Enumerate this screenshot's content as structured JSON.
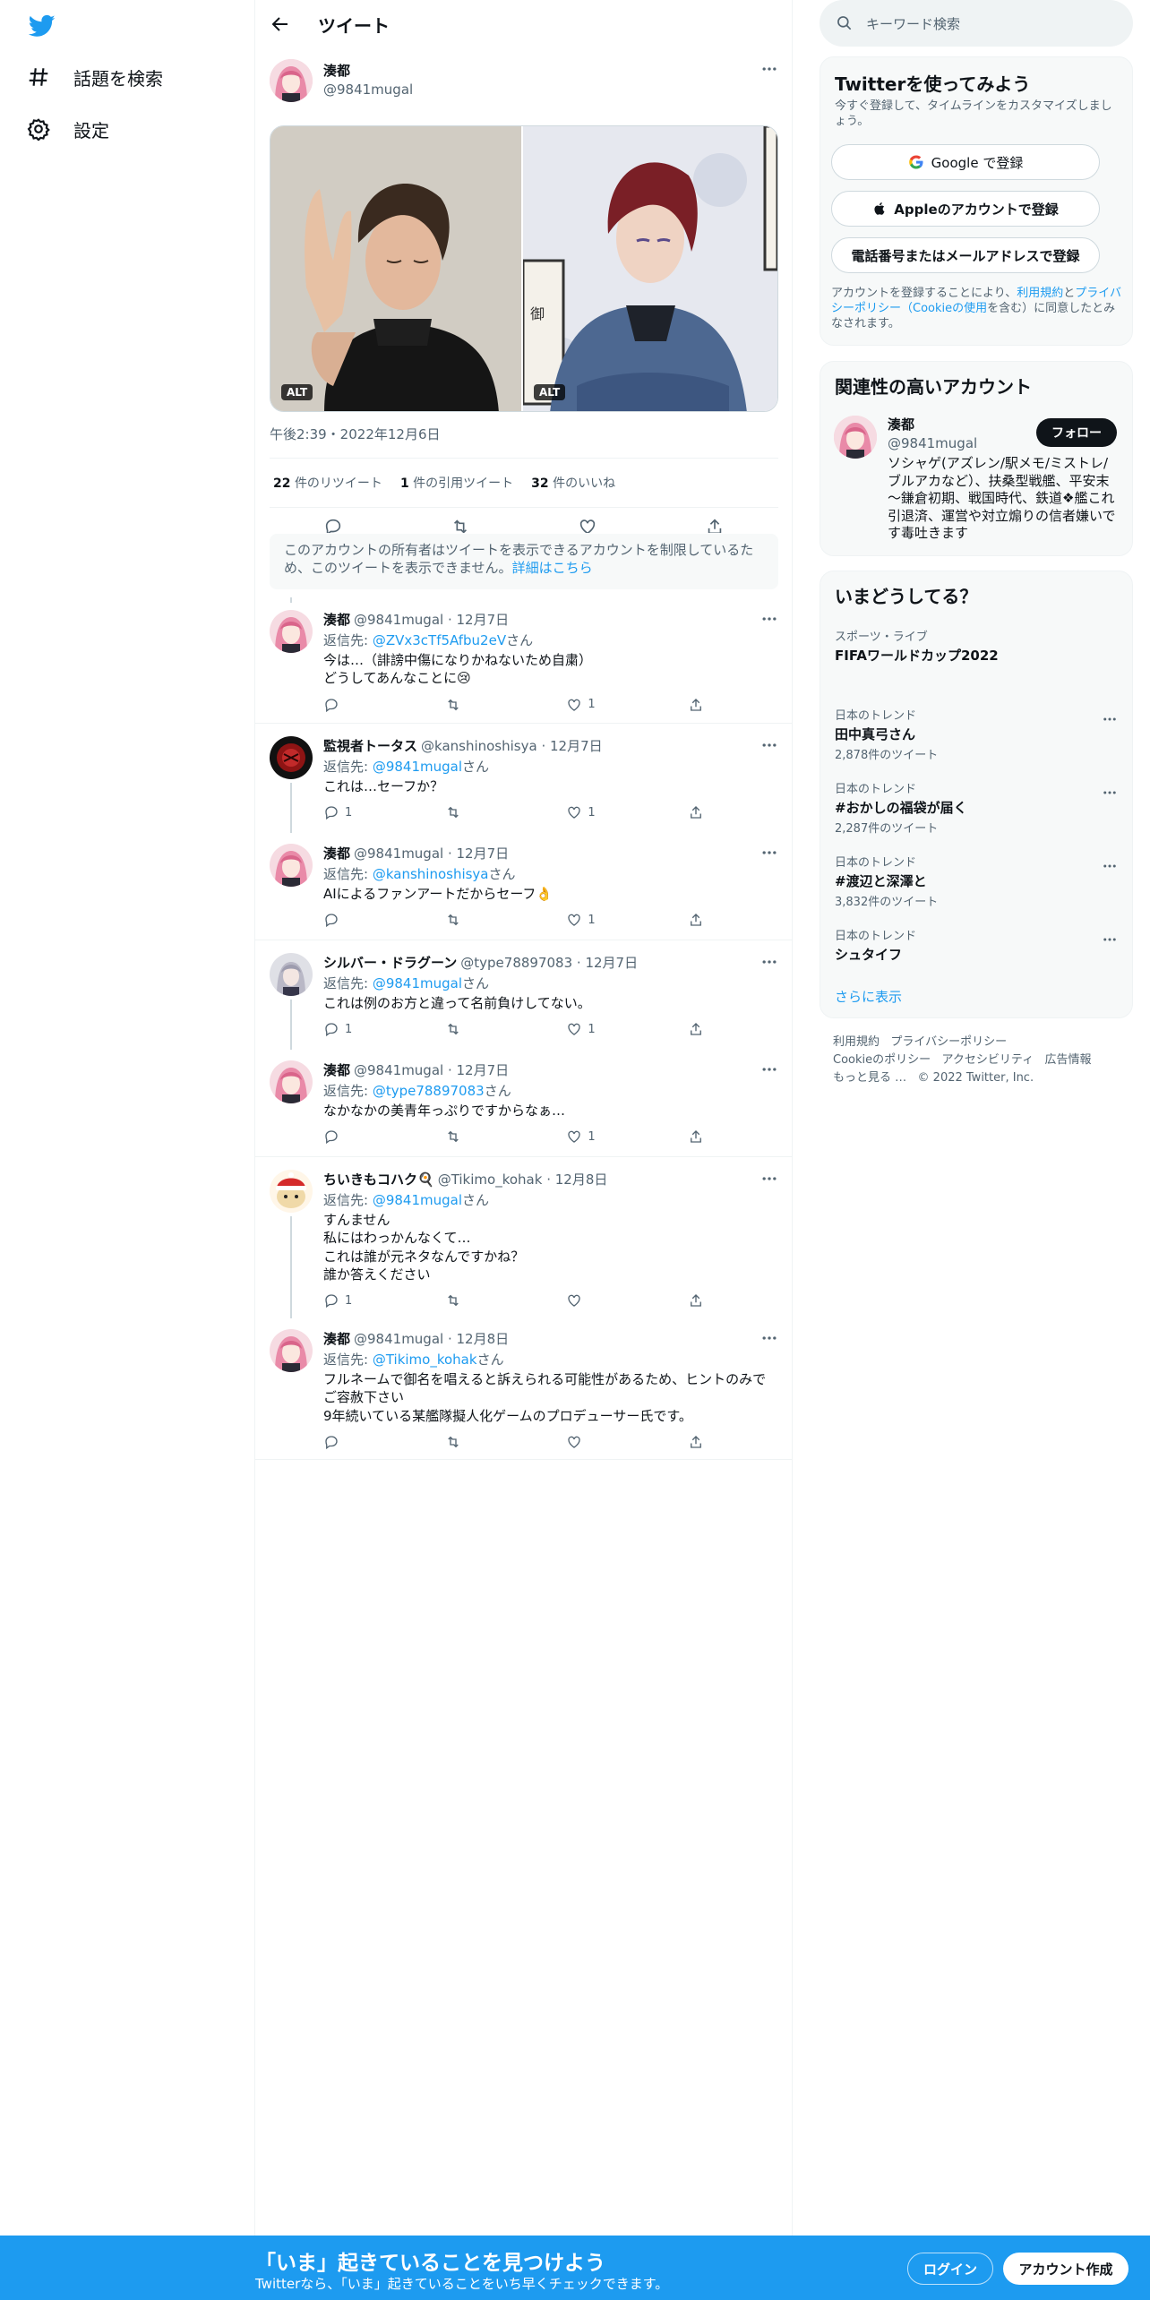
{
  "nav": {
    "search_label": "話題を検索",
    "settings_label": "設定"
  },
  "header": {
    "title": "ツイート"
  },
  "tweet": {
    "author_name": "湊都",
    "author_handle": "@9841mugal",
    "alt1": "ALT",
    "alt2": "ALT",
    "timestamp": "午後2:39・2022年12月6日",
    "retweets_count": "22",
    "retweets_label": "件のリツイート",
    "quotes_count": "1",
    "quotes_label": "件の引用ツイート",
    "likes_count": "32",
    "likes_label": "件のいいね",
    "notice_text": "このアカウントの所有者はツイートを表示できるアカウントを制限しているため、このツイートを表示できません。",
    "notice_link": "詳細はこちら"
  },
  "replies": [
    {
      "name": "湊都",
      "handle": "@9841mugal",
      "date": "12月7日",
      "reply_prefix": "返信先: ",
      "reply_to": "@ZVx3cTf5Afbu2eV",
      "reply_suffix": "さん",
      "text": "今は…（誹謗中傷になりかねないため自粛）\nどうしてあんなことに😢",
      "replies": "",
      "retweets": "",
      "likes": "1"
    },
    {
      "name": "監視者トータス",
      "handle": "@kanshinoshisya",
      "date": "12月7日",
      "reply_prefix": "返信先: ",
      "reply_to": "@9841mugal",
      "reply_suffix": "さん",
      "text": "これは…セーフか？",
      "replies": "1",
      "retweets": "",
      "likes": "1"
    },
    {
      "name": "湊都",
      "handle": "@9841mugal",
      "date": "12月7日",
      "reply_prefix": "返信先: ",
      "reply_to": "@kanshinoshisya",
      "reply_suffix": "さん",
      "text": "AIによるファンアートだからセーフ👌",
      "replies": "",
      "retweets": "",
      "likes": "1"
    },
    {
      "name": "シルバー・ドラグーン",
      "handle": "@type78897083",
      "date": "12月7日",
      "reply_prefix": "返信先: ",
      "reply_to": "@9841mugal",
      "reply_suffix": "さん",
      "text": "これは例のお方と違って名前負けしてない。",
      "replies": "1",
      "retweets": "",
      "likes": "1"
    },
    {
      "name": "湊都",
      "handle": "@9841mugal",
      "date": "12月7日",
      "reply_prefix": "返信先: ",
      "reply_to": "@type78897083",
      "reply_suffix": "さん",
      "text": "なかなかの美青年っぷりですからなぁ…",
      "replies": "",
      "retweets": "",
      "likes": "1"
    },
    {
      "name": "ちいきもコハク🍳",
      "handle": "@Tikimo_kohak",
      "date": "12月8日",
      "reply_prefix": "返信先: ",
      "reply_to": "@9841mugal",
      "reply_suffix": "さん",
      "text": "すんません\n私にはわっかんなくて…\nこれは誰が元ネタなんですかね？\n誰か答えください",
      "replies": "1",
      "retweets": "",
      "likes": ""
    },
    {
      "name": "湊都",
      "handle": "@9841mugal",
      "date": "12月8日",
      "reply_prefix": "返信先: ",
      "reply_to": "@Tikimo_kohak",
      "reply_suffix": "さん",
      "text": "フルネームで御名を唱えると訴えられる可能性があるため、ヒントのみでご容赦下さい\n9年続いている某艦隊擬人化ゲームのプロデューサー氏です。",
      "replies": "",
      "retweets": "",
      "likes": ""
    }
  ],
  "sidebar": {
    "search_placeholder": "キーワード検索",
    "signup": {
      "title": "Twitterを使ってみよう",
      "subtitle": "今すぐ登録して、タイムラインをカスタマイズしましょう。",
      "google": "Google で登録",
      "apple": "Appleのアカウントで登録",
      "phone": "電話番号またはメールアドレスで登録",
      "terms_pre": "アカウントを登録することにより、",
      "terms_link": "利用規約",
      "terms_and": "と",
      "privacy_link": "プライバシーポリシー（Cookieの使用",
      "terms_post": "を含む）に同意したとみなされます。"
    },
    "relevant": {
      "title": "関連性の高いアカウント",
      "name": "湊都",
      "handle": "@9841mugal",
      "follow": "フォロー",
      "bio": "ソシャゲ(アズレン/駅メモ/ミストレ/ブルアカなど）、扶桑型戦艦、平安末～鎌倉初期、戦国時代、鉄道❖艦これ引退済、運営や対立煽りの信者嫌いです毒吐きます"
    },
    "trends": {
      "title": "いまどうしてる？",
      "items": [
        {
          "category": "スポーツ・ライブ",
          "name": "FIFAワールドカップ2022",
          "count": ""
        },
        {
          "category": "日本のトレンド",
          "name": "田中真弓さん",
          "count": "2,878件のツイート"
        },
        {
          "category": "日本のトレンド",
          "name": "#おかしの福袋が届く",
          "count": "2,287件のツイート"
        },
        {
          "category": "日本のトレンド",
          "name": "#渡辺と深澤と",
          "count": "3,832件のツイート"
        },
        {
          "category": "日本のトレンド",
          "name": "シュタイフ",
          "count": ""
        }
      ],
      "show_more": "さらに表示"
    },
    "footer": {
      "terms": "利用規約",
      "privacy": "プライバシーポリシー",
      "cookie": "Cookieのポリシー",
      "access": "アクセシビリティ",
      "ads": "広告情報",
      "more": "もっと見る …",
      "copy": "© 2022 Twitter, Inc."
    }
  },
  "bottom_bar": {
    "title": "「いま」起きていることを見つけよう",
    "subtitle": "Twitterなら、「いま」起きていることをいち早くチェックできます。",
    "login": "ログイン",
    "signup": "アカウント作成"
  },
  "colors": {
    "accent": "#1d9bf0",
    "text": "#0f1419",
    "muted": "#536471"
  }
}
